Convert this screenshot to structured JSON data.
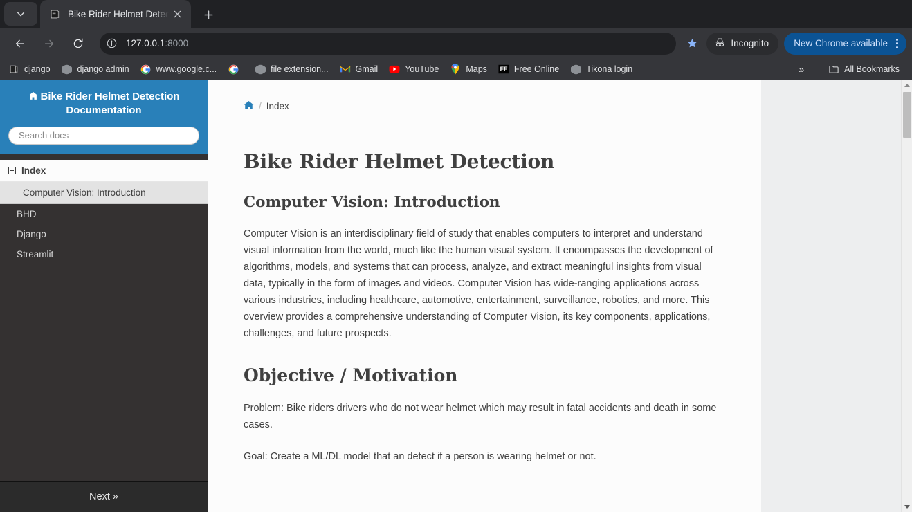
{
  "browser": {
    "tab": {
      "title": "Bike Rider Helmet Detect",
      "favicon_icon": "book-icon",
      "close_icon": "close-icon",
      "search_tabs_icon": "chevron-down-icon",
      "new_tab_icon": "plus-icon"
    },
    "toolbar": {
      "back_icon": "arrow-left-icon",
      "forward_icon": "arrow-right-icon",
      "reload_icon": "reload-icon",
      "site_info_icon": "info-circle-icon",
      "url_host": "127.0.0.1",
      "url_port": ":8000",
      "url_full": "127.0.0.1:8000",
      "star_icon": "star-icon",
      "incognito_label": "Incognito",
      "incognito_icon": "incognito-icon",
      "update_label": "New Chrome available",
      "menu_icon": "kebab-menu-icon",
      "accent_blue": "#0b5394"
    },
    "bookmarks": {
      "items": [
        {
          "label": "django",
          "icon": "book-icon"
        },
        {
          "label": "django admin",
          "icon": "globe-icon"
        },
        {
          "label": "www.google.c...",
          "icon": "google-icon"
        },
        {
          "label": "",
          "icon": "google-icon"
        },
        {
          "label": "file extension...",
          "icon": "globe-icon"
        },
        {
          "label": "Gmail",
          "icon": "gmail-icon"
        },
        {
          "label": "YouTube",
          "icon": "youtube-icon"
        },
        {
          "label": "Maps",
          "icon": "maps-pin-icon"
        },
        {
          "label": "Free Online",
          "icon": "ff-icon"
        },
        {
          "label": "Tikona login",
          "icon": "globe-icon"
        }
      ],
      "overflow_icon": "chevron-double-right-icon",
      "all_bookmarks_label": "All Bookmarks",
      "all_bookmarks_icon": "folder-icon"
    }
  },
  "sidebar": {
    "brand_title": "Bike Rider Helmet Detection Documentation",
    "brand_icon": "home-icon",
    "search_placeholder": "Search docs",
    "search_value": "",
    "header_color": "#2980b9",
    "toc_root": {
      "label": "Index",
      "toggle_icon": "collapse-box-icon"
    },
    "toc_items": [
      {
        "label": "Computer Vision: Introduction",
        "current": true
      },
      {
        "label": "BHD",
        "current": false
      },
      {
        "label": "Django",
        "current": false
      },
      {
        "label": "Streamlit",
        "current": false
      }
    ],
    "next_label": "Next »"
  },
  "content": {
    "breadcrumb": {
      "home_icon": "home-icon",
      "separator": "/",
      "current": "Index"
    },
    "h1": "Bike Rider Helmet Detection",
    "section1_heading": "Computer Vision: Introduction",
    "section1_paragraph": "Computer Vision is an interdisciplinary field of study that enables computers to interpret and understand visual information from the world, much like the human visual system. It encompasses the development of algorithms, models, and systems that can process, analyze, and extract meaningful insights from visual data, typically in the form of images and videos. Computer Vision has wide-ranging applications across various industries, including healthcare, automotive, entertainment, surveillance, robotics, and more. This overview provides a comprehensive understanding of Computer Vision, its key components, applications, challenges, and future prospects.",
    "section2_heading": "Objective / Motivation",
    "section2_paragraph1": "Problem: Bike riders drivers who do not wear helmet which may result in fatal accidents and death in some cases.",
    "section2_paragraph2": "Goal: Create a ML/DL model that an detect if a person is wearing helmet or not."
  },
  "scrollbar": {
    "up_arrow_icon": "triangle-up-icon",
    "down_arrow_icon": "triangle-down-icon"
  }
}
